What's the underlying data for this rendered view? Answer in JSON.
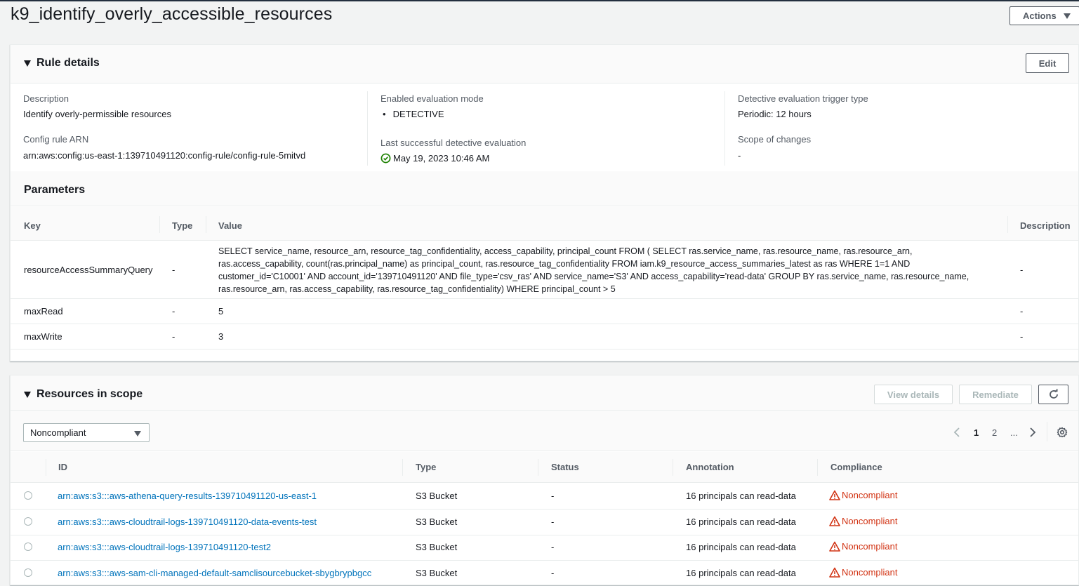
{
  "page": {
    "title": "k9_identify_overly_accessible_resources",
    "actions_label": "Actions"
  },
  "rule_details": {
    "title": "Rule details",
    "edit_label": "Edit",
    "description_label": "Description",
    "description_value": "Identify overly-permissible resources",
    "arn_label": "Config rule ARN",
    "arn_value": "arn:aws:config:us-east-1:139710491120:config-rule/config-rule-5mitvd",
    "eval_mode_label": "Enabled evaluation mode",
    "eval_mode_value": "DETECTIVE",
    "last_eval_label": "Last successful detective evaluation",
    "last_eval_value": "May 19, 2023 10:46 AM",
    "trigger_label": "Detective evaluation trigger type",
    "trigger_value": "Periodic: 12 hours",
    "scope_label": "Scope of changes",
    "scope_value": "-"
  },
  "parameters": {
    "title": "Parameters",
    "columns": [
      "Key",
      "Type",
      "Value",
      "Description"
    ],
    "rows": [
      {
        "key": "resourceAccessSummaryQuery",
        "type": "-",
        "value": "SELECT service_name, resource_arn, resource_tag_confidentiality, access_capability, principal_count FROM ( SELECT ras.service_name, ras.resource_name, ras.resource_arn, ras.access_capability, count(ras.principal_name) as principal_count, ras.resource_tag_confidentiality FROM iam.k9_resource_access_summaries_latest as ras WHERE 1=1 AND customer_id='C10001' AND account_id='139710491120' AND file_type='csv_ras' AND service_name='S3' AND access_capability='read-data' GROUP BY ras.service_name, ras.resource_name, ras.resource_arn, ras.access_capability, ras.resource_tag_confidentiality) WHERE principal_count > 5",
        "description": "-"
      },
      {
        "key": "maxRead",
        "type": "-",
        "value": "5",
        "description": "-"
      },
      {
        "key": "maxWrite",
        "type": "-",
        "value": "3",
        "description": "-"
      }
    ]
  },
  "resources": {
    "title": "Resources in scope",
    "view_details_label": "View details",
    "remediate_label": "Remediate",
    "filter_selected": "Noncompliant",
    "pagination": {
      "current": "1",
      "pages": [
        "1",
        "2",
        "..."
      ]
    },
    "columns": [
      "ID",
      "Type",
      "Status",
      "Annotation",
      "Compliance"
    ],
    "rows": [
      {
        "id": "arn:aws:s3:::aws-athena-query-results-139710491120-us-east-1",
        "type": "S3 Bucket",
        "status": "-",
        "annotation": "16 principals can read-data",
        "compliance": "Noncompliant"
      },
      {
        "id": "arn:aws:s3:::aws-cloudtrail-logs-139710491120-data-events-test",
        "type": "S3 Bucket",
        "status": "-",
        "annotation": "16 principals can read-data",
        "compliance": "Noncompliant"
      },
      {
        "id": "arn:aws:s3:::aws-cloudtrail-logs-139710491120-test2",
        "type": "S3 Bucket",
        "status": "-",
        "annotation": "16 principals can read-data",
        "compliance": "Noncompliant"
      },
      {
        "id": "arn:aws:s3:::aws-sam-cli-managed-default-samclisourcebucket-sbygbrypbgcc",
        "type": "S3 Bucket",
        "status": "-",
        "annotation": "16 principals can read-data",
        "compliance": "Noncompliant"
      }
    ]
  },
  "colors": {
    "link": "#0073bb",
    "noncompliant": "#d13212",
    "success": "#1d8102"
  }
}
